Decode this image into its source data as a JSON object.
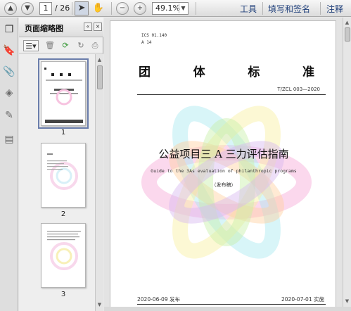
{
  "toolbar": {
    "page_current": "1",
    "page_total": "/ 26",
    "zoom": "49.1%",
    "tools_label": "工具",
    "fill_sign_label": "填写和签名",
    "comment_label": "注释"
  },
  "thumbnail_panel": {
    "title": "页面缩略图",
    "pages": [
      {
        "number": "1"
      },
      {
        "number": "2"
      },
      {
        "number": "3"
      }
    ]
  },
  "document": {
    "ics": "ICS  01.140",
    "classification": "A 14",
    "standard_type_chars": [
      "团",
      "体",
      "标",
      "准"
    ],
    "standard_code": "T/ZCL 003—2020",
    "title": "公益项目三 A 三力评估指南",
    "subtitle": "Guide to the 3As evaluation of philanthropic programs",
    "draft_note": "（发布稿）",
    "publish_date": "2020-06-09 发布",
    "implement_date": "2020-07-01 实施"
  },
  "colors": {
    "toolbar_text": "#1f3f7a",
    "flower": [
      "#f7a8d8",
      "#a8e8f0",
      "#f8f0a0",
      "#ffd0a0",
      "#c8f0a8",
      "#d8b8f0"
    ]
  }
}
